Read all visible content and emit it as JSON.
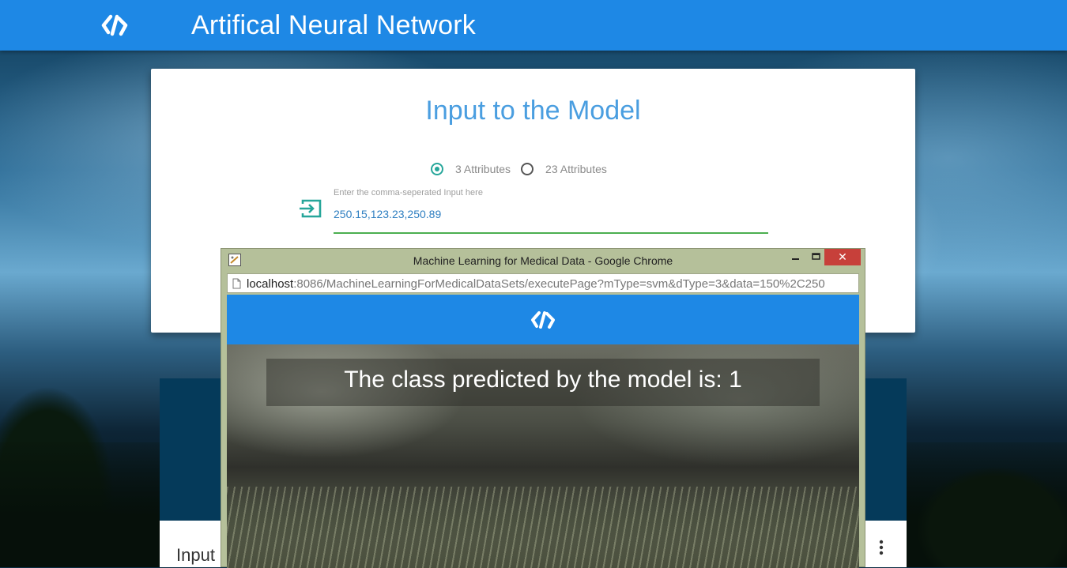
{
  "app": {
    "title": "Artifical Neural Network",
    "brand_color": "#1e88e5"
  },
  "input_card": {
    "heading": "Input to the Model",
    "radio_options": [
      {
        "label": "3 Attributes",
        "selected": true
      },
      {
        "label": "23 Attributes",
        "selected": false
      }
    ],
    "field_label": "Enter the comma-seperated Input here",
    "field_value": "250.15,123.23,250.89",
    "accent_color": "#26a69a"
  },
  "lower_panel": {
    "label": "Input"
  },
  "popup": {
    "window_title": "Machine Learning for Medical Data - Google Chrome",
    "close_glyph": "✕",
    "url_host": "localhost",
    "url_rest": ":8086/MachineLearningForMedicalDataSets/executePage?mType=svm&dType=3&data=150%2C250",
    "result_text": "The class predicted by the model is: 1"
  }
}
